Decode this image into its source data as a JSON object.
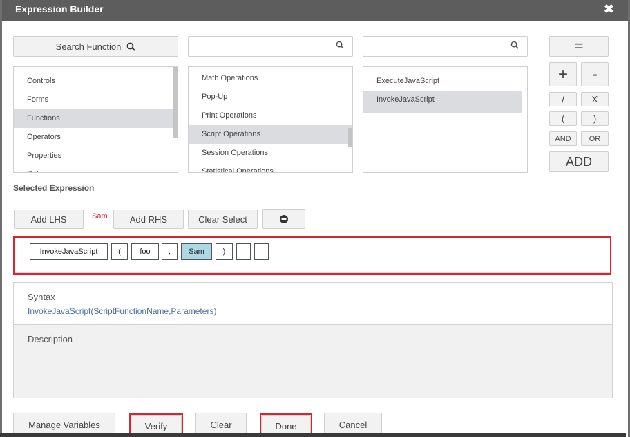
{
  "dialog": {
    "title": "Expression Builder",
    "close_glyph": "✖"
  },
  "search": {
    "button_label": "Search Function",
    "icon": "search-icon",
    "input2_placeholder": "",
    "input3_placeholder": ""
  },
  "list1": {
    "items": [
      "Controls",
      "Forms",
      "Functions",
      "Operators",
      "Properties",
      "Rules"
    ],
    "selected": "Functions"
  },
  "list2": {
    "items": [
      "Math Operations",
      "Pop-Up",
      "Print Operations",
      "Script Operations",
      "Session Operations",
      "Statistical Operations"
    ],
    "selected": "Script Operations"
  },
  "list3": {
    "items": [
      "ExecuteJavaScript",
      "InvokeJavaScript"
    ],
    "selected": "InvokeJavaScript"
  },
  "operators": {
    "equals": "=",
    "plus": "+",
    "minus": "-",
    "divide": "/",
    "multiply": "X",
    "open_paren": "(",
    "close_paren": ")",
    "and": "AND",
    "or": "OR",
    "add": "ADD"
  },
  "selected_expression": {
    "label": "Selected Expression",
    "add_lhs": "Add LHS",
    "lhs_value": "Sam",
    "add_rhs": "Add RHS",
    "clear_select": "Clear Select",
    "remove_icon": "minus-circle-icon",
    "tokens": [
      "InvokeJavaScript",
      "(",
      "foo",
      ",",
      "Sam",
      ")",
      "",
      ""
    ],
    "highlighted_token": "Sam"
  },
  "syntax": {
    "label": "Syntax",
    "text": "InvokeJavaScript(ScriptFunctionName,Parameters)"
  },
  "description": {
    "label": "Description",
    "text": ""
  },
  "footer": {
    "manage_variables": "Manage Variables",
    "verify": "Verify",
    "clear": "Clear",
    "done": "Done",
    "cancel": "Cancel"
  },
  "colors": {
    "titlebar": "#5d5d5d",
    "highlight_frame": "#d72631",
    "token_highlight": "#add8e6",
    "lhs_value": "#d72631",
    "syntax_text": "#4a6fa5",
    "list_selected": "#dadce0"
  }
}
